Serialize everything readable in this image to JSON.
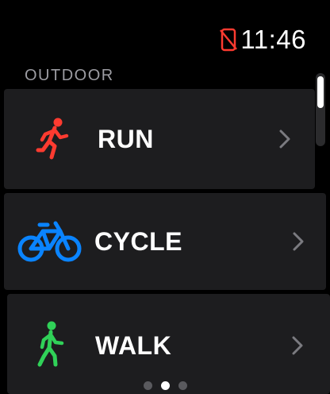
{
  "status_bar": {
    "time": "11:46",
    "phone_disconnected_icon": "phone-slash-icon",
    "alert_color": "#ff3b30"
  },
  "section": {
    "label": "OUTDOOR"
  },
  "workouts": [
    {
      "label": "RUN",
      "icon": "running-figure-icon",
      "color": "#ff3b30"
    },
    {
      "label": "CYCLE",
      "icon": "bicycle-icon",
      "color": "#0a84ff"
    },
    {
      "label": "WALK",
      "icon": "walking-figure-icon",
      "color": "#30d158"
    }
  ],
  "page_indicator": {
    "count": 3,
    "active_index": 1
  }
}
